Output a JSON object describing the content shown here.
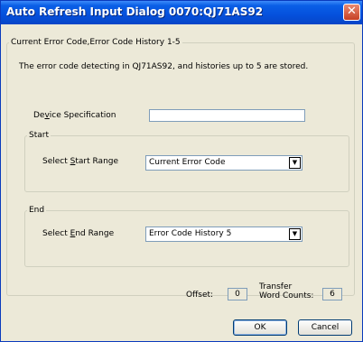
{
  "window": {
    "title": "Auto Refresh Input Dialog 0070:QJ71AS92",
    "close_glyph": "✕"
  },
  "main_group": {
    "legend": "Current Error Code,Error Code History 1-5",
    "description": "The error code detecting in QJ71AS92, and histories up to 5 are stored."
  },
  "device": {
    "label_pre": "De",
    "label_key": "v",
    "label_post": "ice Specification",
    "value": ""
  },
  "start": {
    "legend": "Start",
    "label_pre": "Select ",
    "label_key": "S",
    "label_post": "tart Range",
    "selected": "Current Error Code"
  },
  "end": {
    "legend": "End",
    "label_pre": "Select ",
    "label_key": "E",
    "label_post": "nd Range",
    "selected": "Error Code History 5"
  },
  "offset": {
    "label": "Offset:",
    "value": "0"
  },
  "transfer": {
    "label_line1": "Transfer",
    "label_line2": "Word Counts:",
    "value": "6"
  },
  "buttons": {
    "ok": "OK",
    "cancel": "Cancel"
  },
  "icons": {
    "dropdown_arrow": "▼"
  }
}
